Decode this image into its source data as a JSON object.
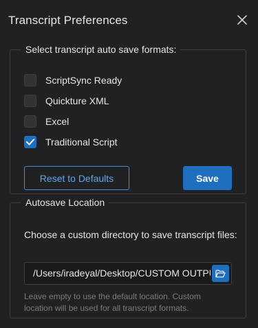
{
  "dialog": {
    "title": "Transcript Preferences",
    "close_icon": "close-icon"
  },
  "formats": {
    "legend": "Select transcript auto save formats:",
    "options": [
      {
        "label": "ScriptSync Ready",
        "checked": false
      },
      {
        "label": "Quickture XML",
        "checked": false
      },
      {
        "label": "Excel",
        "checked": false
      },
      {
        "label": "Traditional Script",
        "checked": true
      }
    ],
    "reset_label": "Reset to Defaults",
    "save_label": "Save"
  },
  "location": {
    "legend": "Autosave Location",
    "description": "Choose a custom directory to save transcript files:",
    "path_value": "/Users/iradeyal/Desktop/CUSTOM OUTPUT",
    "folder_icon": "folder-open-icon",
    "hint": "Leave empty to use the default location. Custom location will be used for all transcript formats."
  },
  "colors": {
    "background": "#212123",
    "accent": "#1f6fbf",
    "accent_text": "#5ca8f0",
    "border": "#3f3f42",
    "hint_text": "#7c7c80"
  }
}
